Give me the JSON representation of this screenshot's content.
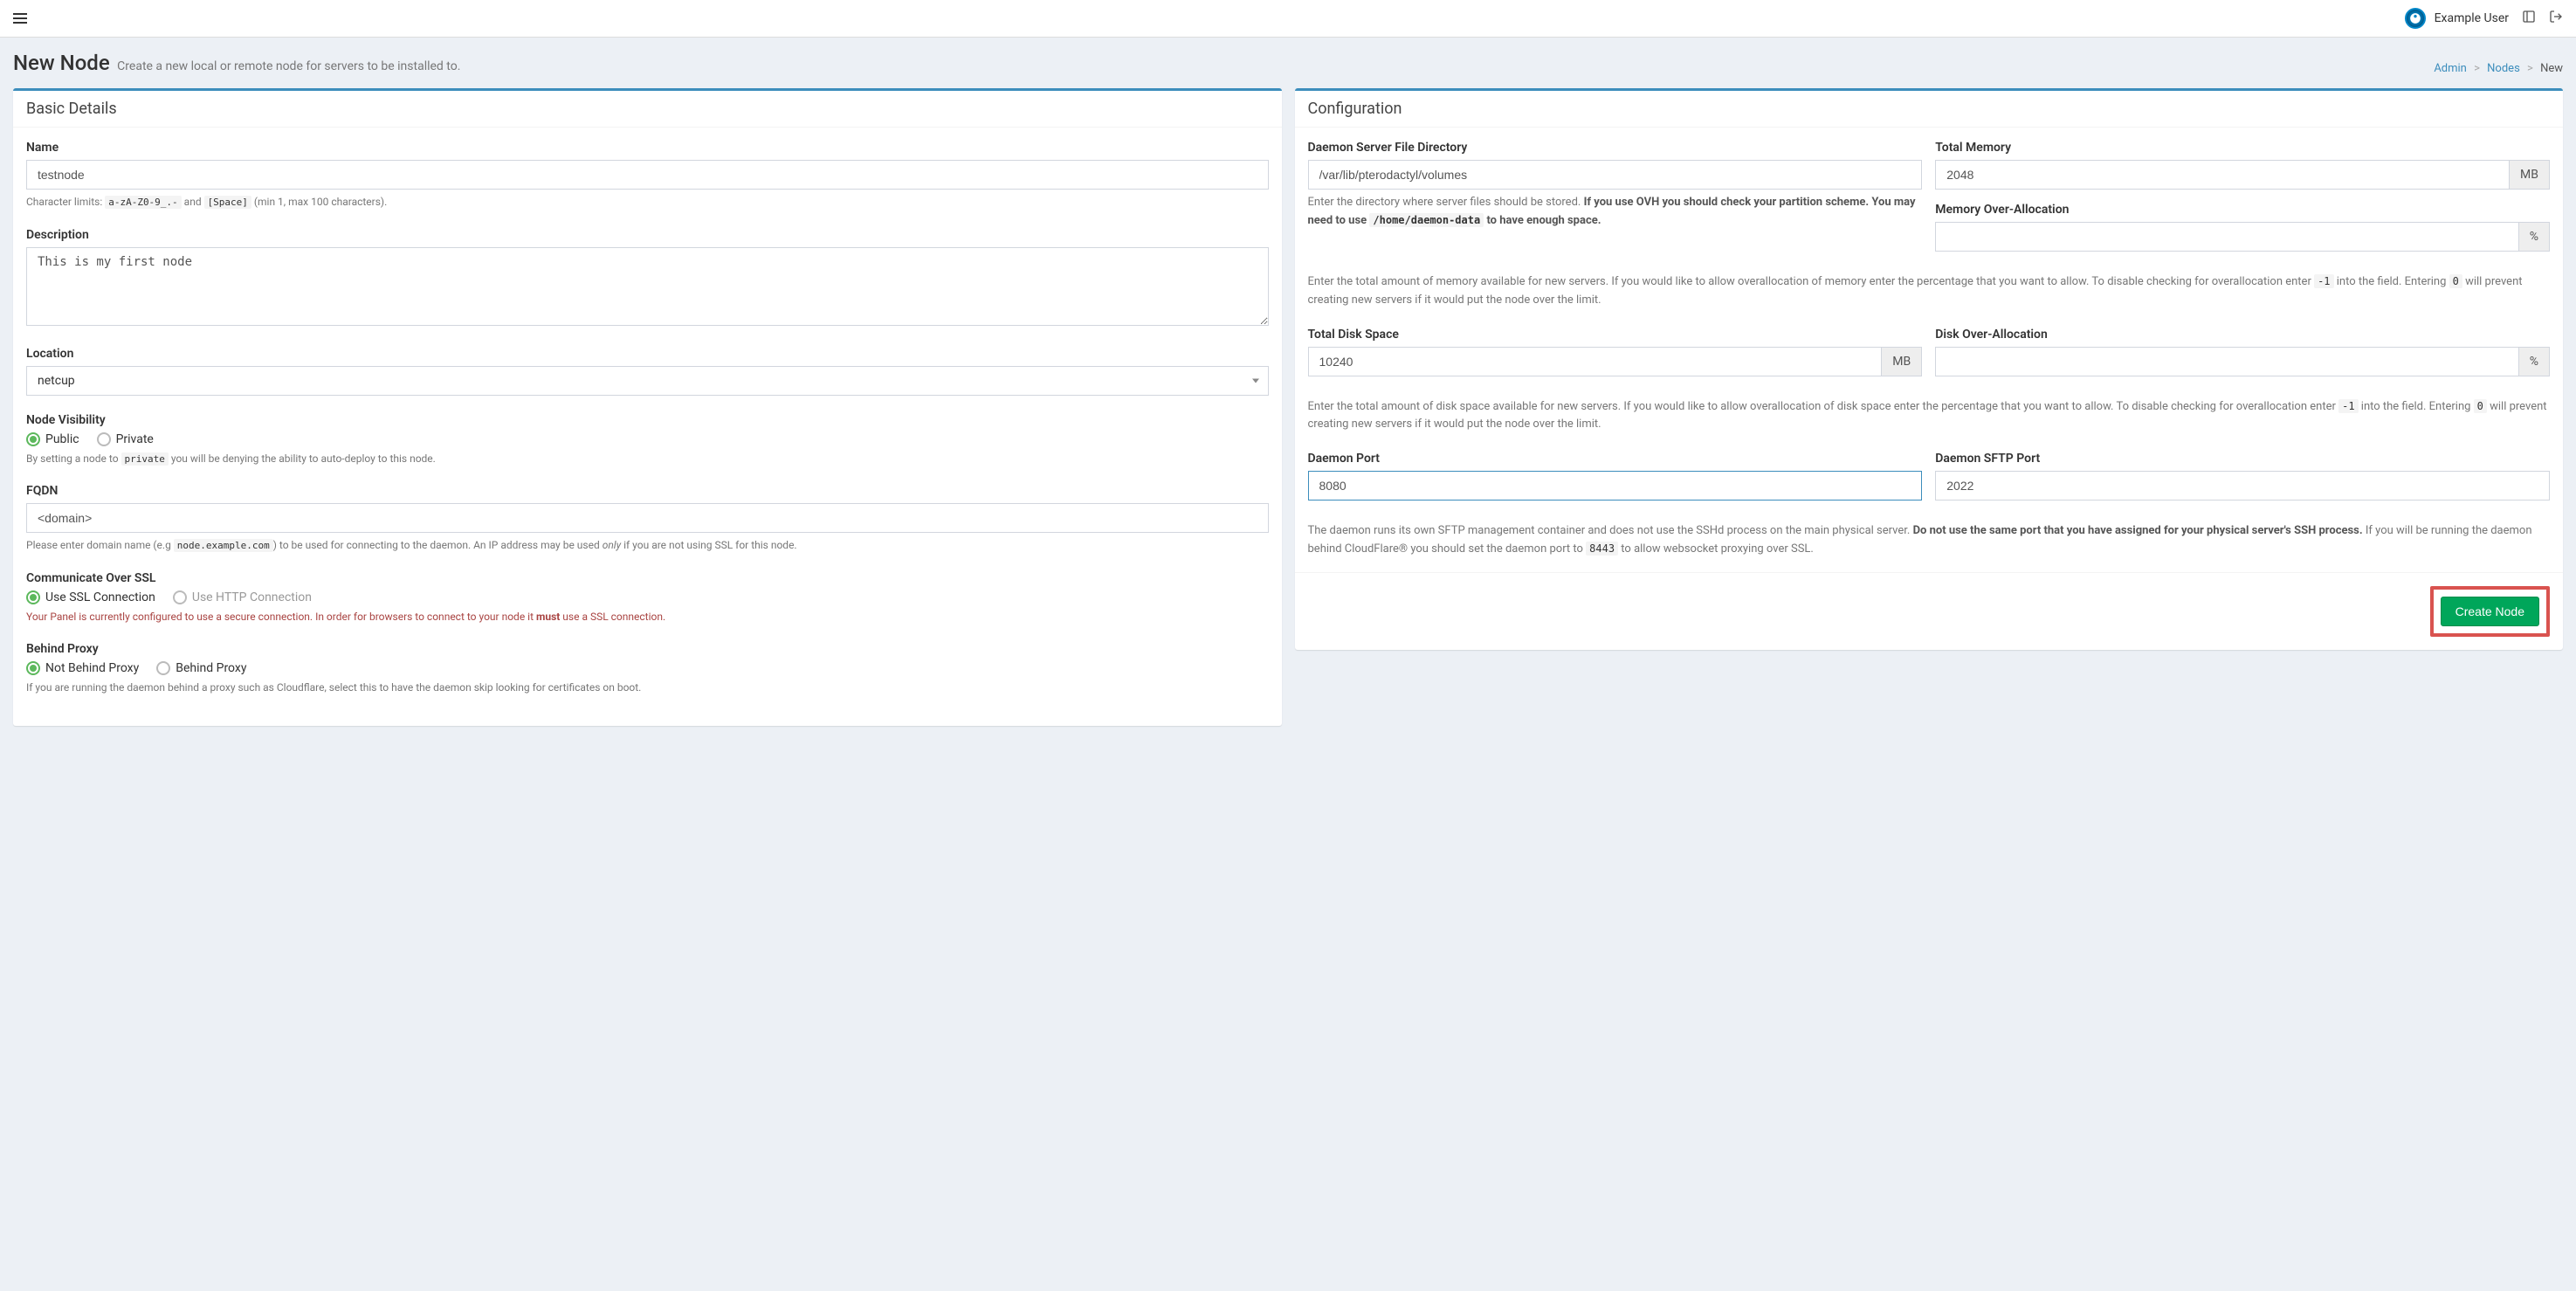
{
  "topbar": {
    "user_name": "Example User"
  },
  "header": {
    "title": "New Node",
    "subtitle": "Create a new local or remote node for servers to be installed to."
  },
  "breadcrumb": {
    "admin": "Admin",
    "nodes": "Nodes",
    "new": "New"
  },
  "basic": {
    "panel_title": "Basic Details",
    "name_label": "Name",
    "name_value": "testnode",
    "name_help_prefix": "Character limits: ",
    "name_help_code1": "a-zA-Z0-9_.-",
    "name_help_mid": " and ",
    "name_help_code2": "[Space]",
    "name_help_suffix": " (min 1, max 100 characters).",
    "desc_label": "Description",
    "desc_value": "This is my first node",
    "location_label": "Location",
    "location_value": "netcup",
    "visibility_label": "Node Visibility",
    "visibility_public": "Public",
    "visibility_private": "Private",
    "visibility_help_prefix": "By setting a node to ",
    "visibility_help_code": "private",
    "visibility_help_suffix": " you will be denying the ability to auto-deploy to this node.",
    "fqdn_label": "FQDN",
    "fqdn_value": "<domain>",
    "fqdn_help_prefix": "Please enter domain name (e.g ",
    "fqdn_help_code": "node.example.com",
    "fqdn_help_mid": ") to be used for connecting to the daemon. An IP address may be used ",
    "fqdn_help_only": "only",
    "fqdn_help_suffix": " if you are not using SSL for this node.",
    "ssl_label": "Communicate Over SSL",
    "ssl_use_ssl": "Use SSL Connection",
    "ssl_use_http": "Use HTTP Connection",
    "ssl_help_prefix": "Your Panel is currently configured to use a secure connection. In order for browsers to connect to your node it ",
    "ssl_help_must": "must",
    "ssl_help_suffix": " use a SSL connection.",
    "proxy_label": "Behind Proxy",
    "proxy_not": "Not Behind Proxy",
    "proxy_yes": "Behind Proxy",
    "proxy_help": "If you are running the daemon behind a proxy such as Cloudflare, select this to have the daemon skip looking for certificates on boot."
  },
  "config": {
    "panel_title": "Configuration",
    "dir_label": "Daemon Server File Directory",
    "dir_value": "/var/lib/pterodactyl/volumes",
    "dir_help_prefix": "Enter the directory where server files should be stored. ",
    "dir_help_bold": "If you use OVH you should check your partition scheme. You may need to use ",
    "dir_help_code": "/home/daemon-data",
    "dir_help_bold2": " to have enough space.",
    "total_mem_label": "Total Memory",
    "total_mem_value": "2048",
    "total_mem_unit": "MB",
    "mem_over_label": "Memory Over-Allocation",
    "mem_over_value": "",
    "mem_over_unit": "%",
    "mem_help_prefix": "Enter the total amount of memory available for new servers. If you would like to allow overallocation of memory enter the percentage that you want to allow. To disable checking for overallocation enter ",
    "mem_help_code1": "-1",
    "mem_help_mid": " into the field. Entering ",
    "mem_help_code2": "0",
    "mem_help_suffix": " will prevent creating new servers if it would put the node over the limit.",
    "disk_label": "Total Disk Space",
    "disk_value": "10240",
    "disk_unit": "MB",
    "disk_over_label": "Disk Over-Allocation",
    "disk_over_value": "",
    "disk_over_unit": "%",
    "disk_help_prefix": "Enter the total amount of disk space available for new servers. If you would like to allow overallocation of disk space enter the percentage that you want to allow. To disable checking for overallocation enter ",
    "disk_help_code1": "-1",
    "disk_help_mid": " into the field. Entering ",
    "disk_help_code2": "0",
    "disk_help_suffix": " will prevent creating new servers if it would put the node over the limit.",
    "dport_label": "Daemon Port",
    "dport_value": "8080",
    "sftp_label": "Daemon SFTP Port",
    "sftp_value": "2022",
    "port_help_prefix": "The daemon runs its own SFTP management container and does not use the SSHd process on the main physical server. ",
    "port_help_bold": "Do not use the same port that you have assigned for your physical server's SSH process.",
    "port_help_mid": " If you will be running the daemon behind CloudFlare® you should set the daemon port to ",
    "port_help_code": "8443",
    "port_help_suffix": " to allow websocket proxying over SSL.",
    "submit_label": "Create Node"
  }
}
